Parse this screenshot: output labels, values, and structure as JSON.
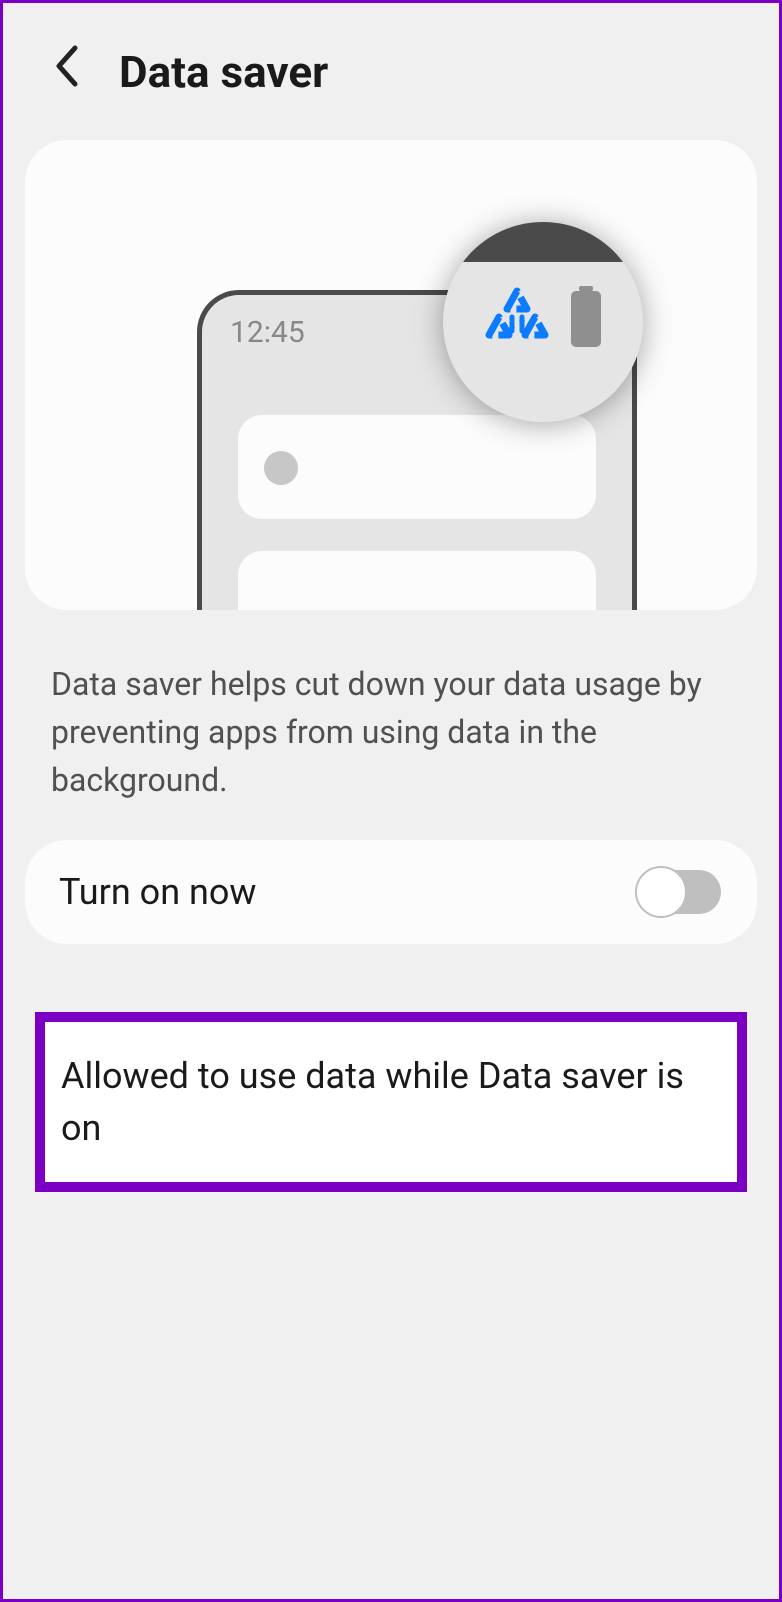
{
  "header": {
    "title": "Data saver"
  },
  "illustration": {
    "time": "12:45"
  },
  "description": "Data saver helps cut down your data usage by preventing apps from using data in the background.",
  "toggle": {
    "label": "Turn on now",
    "on": false
  },
  "allowed": {
    "label": "Allowed to use data while Data saver is on"
  }
}
